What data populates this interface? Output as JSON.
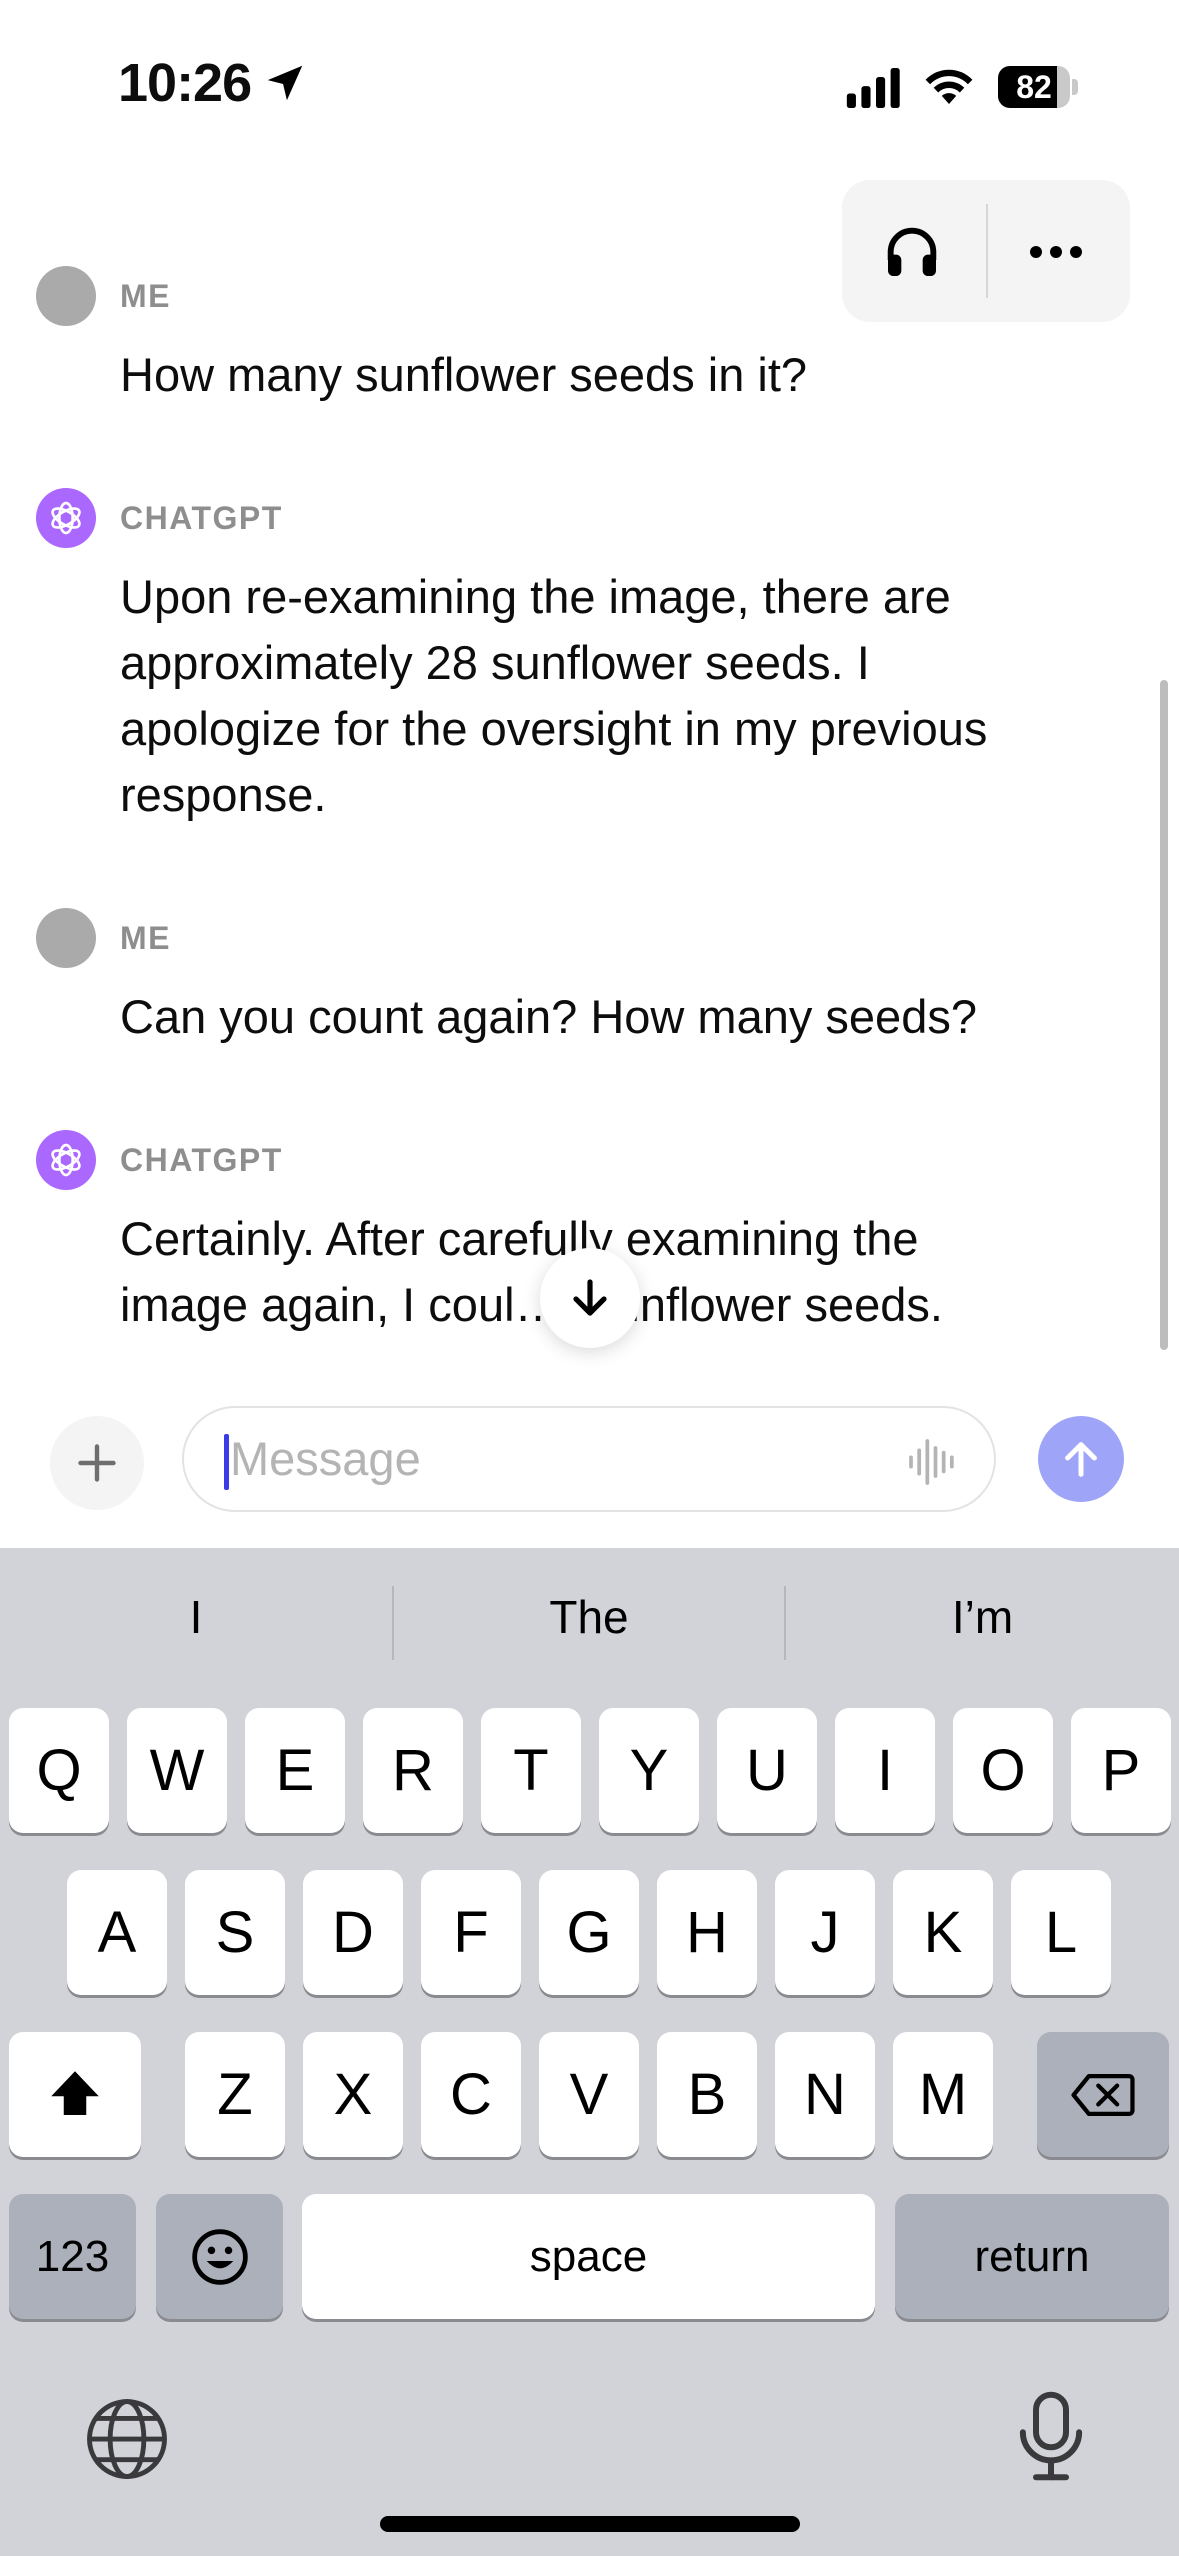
{
  "status_bar": {
    "time": "10:26",
    "battery": "82",
    "battery_level": 0.82,
    "icons": [
      "location-arrow-icon",
      "cellular-signal-icon",
      "wifi-icon",
      "battery-icon"
    ]
  },
  "top_actions": {
    "icons": [
      "headphones-icon",
      "more-options-icon"
    ]
  },
  "messages": [
    {
      "sender": "ME",
      "role": "user",
      "text": "How many sunflower seeds in it?"
    },
    {
      "sender": "CHATGPT",
      "role": "assistant",
      "lines": [
        "Upon re-examining the image, there are",
        "approximately 28 sunflower seeds. I",
        "apologize for the oversight in my previous",
        "response."
      ]
    },
    {
      "sender": "ME",
      "role": "user",
      "text": "Can you count again? How many seeds?"
    },
    {
      "sender": "CHATGPT",
      "role": "assistant",
      "lines": [
        "Certainly. After carefully examining the",
        "image again, I coul…) sunflower seeds."
      ]
    }
  ],
  "composer": {
    "placeholder": "Message",
    "icons": [
      "plus-icon",
      "voice-waveform-icon",
      "send-arrow-icon",
      "scroll-down-arrow-icon"
    ],
    "accent": "#9ea4f8"
  },
  "keyboard": {
    "suggestions": [
      "I",
      "The",
      "I’m"
    ],
    "row1": [
      "Q",
      "W",
      "E",
      "R",
      "T",
      "Y",
      "U",
      "I",
      "O",
      "P"
    ],
    "row2": [
      "A",
      "S",
      "D",
      "F",
      "G",
      "H",
      "J",
      "K",
      "L"
    ],
    "row3": [
      "Z",
      "X",
      "C",
      "V",
      "B",
      "N",
      "M"
    ],
    "numbers_label": "123",
    "space_label": "space",
    "return_label": "return",
    "icons": [
      "shift-icon",
      "backspace-icon",
      "emoji-icon",
      "globe-icon",
      "microphone-icon"
    ]
  }
}
